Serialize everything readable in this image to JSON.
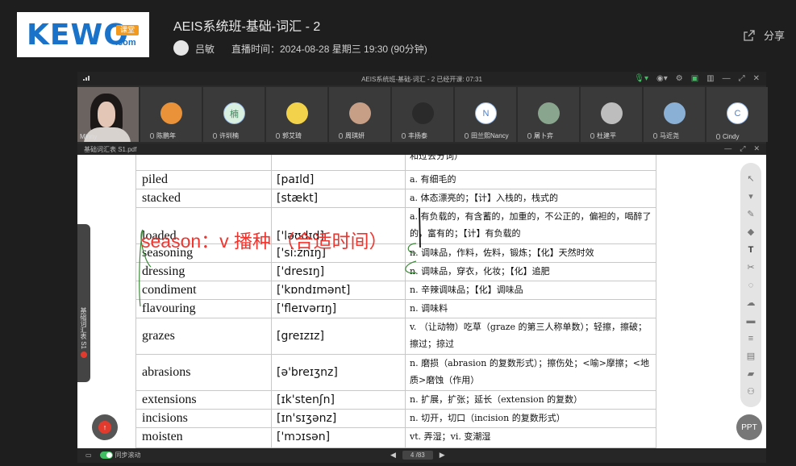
{
  "header": {
    "logo": {
      "word": "KEWO",
      "badge": "课堂",
      "suffix": ".com"
    },
    "title": "AEIS系统班-基础-词汇 - 2",
    "host": "吕敏",
    "live_time": "直播时间：2024-08-28 星期三 19:30 (90分钟)",
    "share_label": "分享"
  },
  "player": {
    "window_title": "AEIS系统班-基础-词汇 - 2    已经开课: 07:31",
    "participants": [
      {
        "name": "Minny",
        "avatar_color": "#6b6360"
      },
      {
        "name": "陈鹏年",
        "avatar_color": "#e9923a"
      },
      {
        "name": "许圳楠",
        "avatar_color": "#d9efe0",
        "initial": "楠"
      },
      {
        "name": "郭艾琦",
        "avatar_color": "#f2d24a"
      },
      {
        "name": "周琪妍",
        "avatar_color": "#c79f86"
      },
      {
        "name": "丰扬泰",
        "avatar_color": "#2a2a2a"
      },
      {
        "name": "田兰熙Nancy",
        "avatar_color": "#ffffff",
        "initial": "N"
      },
      {
        "name": "屠卜弈",
        "avatar_color": "#8aa58e"
      },
      {
        "name": "杜建平",
        "avatar_color": "#bdbdbd"
      },
      {
        "name": "马近尧",
        "avatar_color": "#8bb0d6"
      },
      {
        "name": "Cindy",
        "avatar_color": "#ffffff",
        "initial": "C"
      }
    ],
    "doc_name": "基础词汇表 S1.pdf",
    "side_tab_label": "基础词汇表 S1",
    "sync_scroll_label": "同步滚动",
    "page_indicator": "4 /83"
  },
  "vocab": {
    "head_fragment": "和过去分词）",
    "rows": [
      {
        "word": "piled",
        "ipa": "[paɪld]",
        "meaning": "a. 有细毛的"
      },
      {
        "word": "stacked",
        "ipa": "[stækt]",
        "meaning": "a. 体态漂亮的；【计】入栈的，栈式的"
      },
      {
        "word": "loaded",
        "ipa": "['ləʊdɪd]",
        "meaning": "a. 有负载的，有含蓄的，加重的，不公正的，偏袒的，喝醉了的，富有的；【计】有负载的"
      },
      {
        "word": "seasoning",
        "ipa": "['si:znɪŋ]",
        "meaning": "n. 调味品，作料，佐料，锻炼；【化】天然时效"
      },
      {
        "word": "dressing",
        "ipa": "['dresɪŋ]",
        "meaning": "n. 调味品，穿衣，化妆；【化】追肥"
      },
      {
        "word": "condiment",
        "ipa": "['kɒndɪmənt]",
        "meaning": "n. 辛辣调味品；【化】调味品"
      },
      {
        "word": "flavouring",
        "ipa": "['fleɪvərɪŋ]",
        "meaning": "n. 调味料"
      },
      {
        "word": "grazes",
        "ipa": "[greɪzɪz]",
        "meaning": "v. （让动物）吃草（graze 的第三人称单数）；轻擦，擦破；擦过；掠过"
      },
      {
        "word": "abrasions",
        "ipa": "[ə'breɪʒnz]",
        "meaning": "n. 磨损（abrasion 的复数形式）；擦伤处；<喻>摩擦；<地质>磨蚀（作用）"
      },
      {
        "word": "extensions",
        "ipa": "[ɪk'stenʃn]",
        "meaning": "n. 扩展，扩张；延长（extension 的复数）"
      },
      {
        "word": "incisions",
        "ipa": "[ɪn'sɪʒənz]",
        "meaning": "n. 切开，切口（incision 的复数形式）"
      },
      {
        "word": "moisten",
        "ipa": "['mɔɪsən]",
        "meaning": "vt. 弄湿；vi. 变潮湿"
      }
    ]
  },
  "annotation": {
    "text": "season：v 播种 （合适时间）",
    "color": "#f0342e"
  },
  "toolbar": {
    "tools": [
      "pointer-icon",
      "cursor-icon",
      "pen-icon",
      "eraser-icon",
      "text-icon",
      "scissors-icon",
      "shape-icon",
      "cloud-icon",
      "box-icon",
      "list-icon",
      "document-icon",
      "chat-icon",
      "people-icon"
    ],
    "text_tool": "T"
  },
  "ppt_label": "PPT"
}
